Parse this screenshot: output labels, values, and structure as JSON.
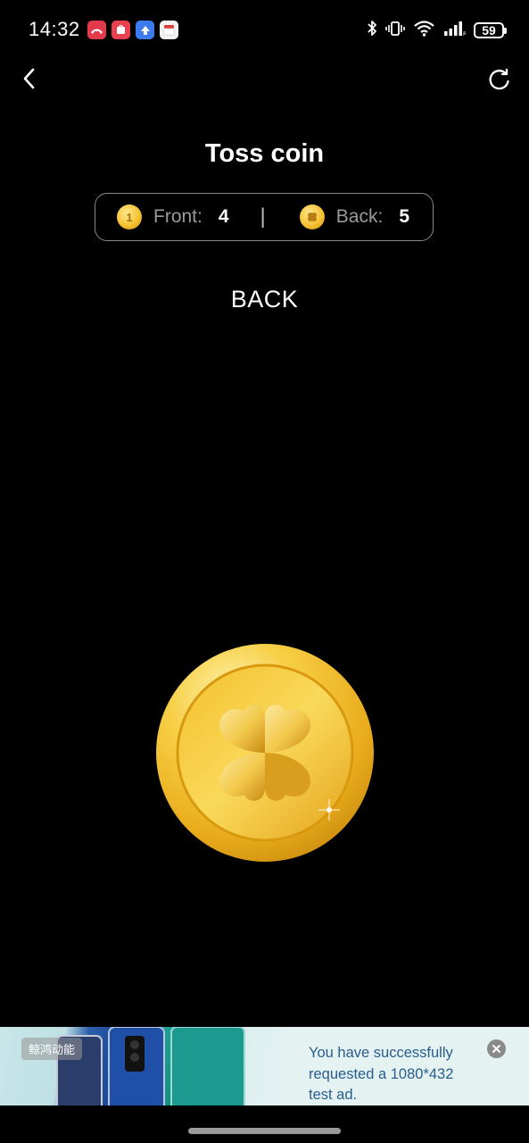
{
  "status_bar": {
    "time": "14:32",
    "battery": "59",
    "notification_icons": [
      {
        "name": "missed-call-icon",
        "color": "#e33a4b"
      },
      {
        "name": "app-gallery-icon",
        "color": "#e8404f"
      },
      {
        "name": "upload-app-icon",
        "color": "#3a7bf0"
      },
      {
        "name": "calendar-app-icon",
        "color": "#f2f2f2"
      }
    ]
  },
  "header": {
    "back_icon": "chevron-left-icon",
    "reset_icon": "refresh-icon",
    "title": "Toss coin"
  },
  "scoreboard": {
    "front_label": "Front:",
    "front_value": "4",
    "divider": "|",
    "back_label": "Back:",
    "back_value": "5"
  },
  "result": "BACK",
  "coin": {
    "face": "back",
    "emblem": "four-leaf-clover-icon",
    "colors": {
      "outer": "#f3c232",
      "inner": "#e7a91f",
      "emblem": "#f9d979"
    }
  },
  "ad": {
    "tag": "鲸鸿动能",
    "text": "You have successfully requested a 1080*432 test ad.",
    "close_icon": "close-icon"
  }
}
